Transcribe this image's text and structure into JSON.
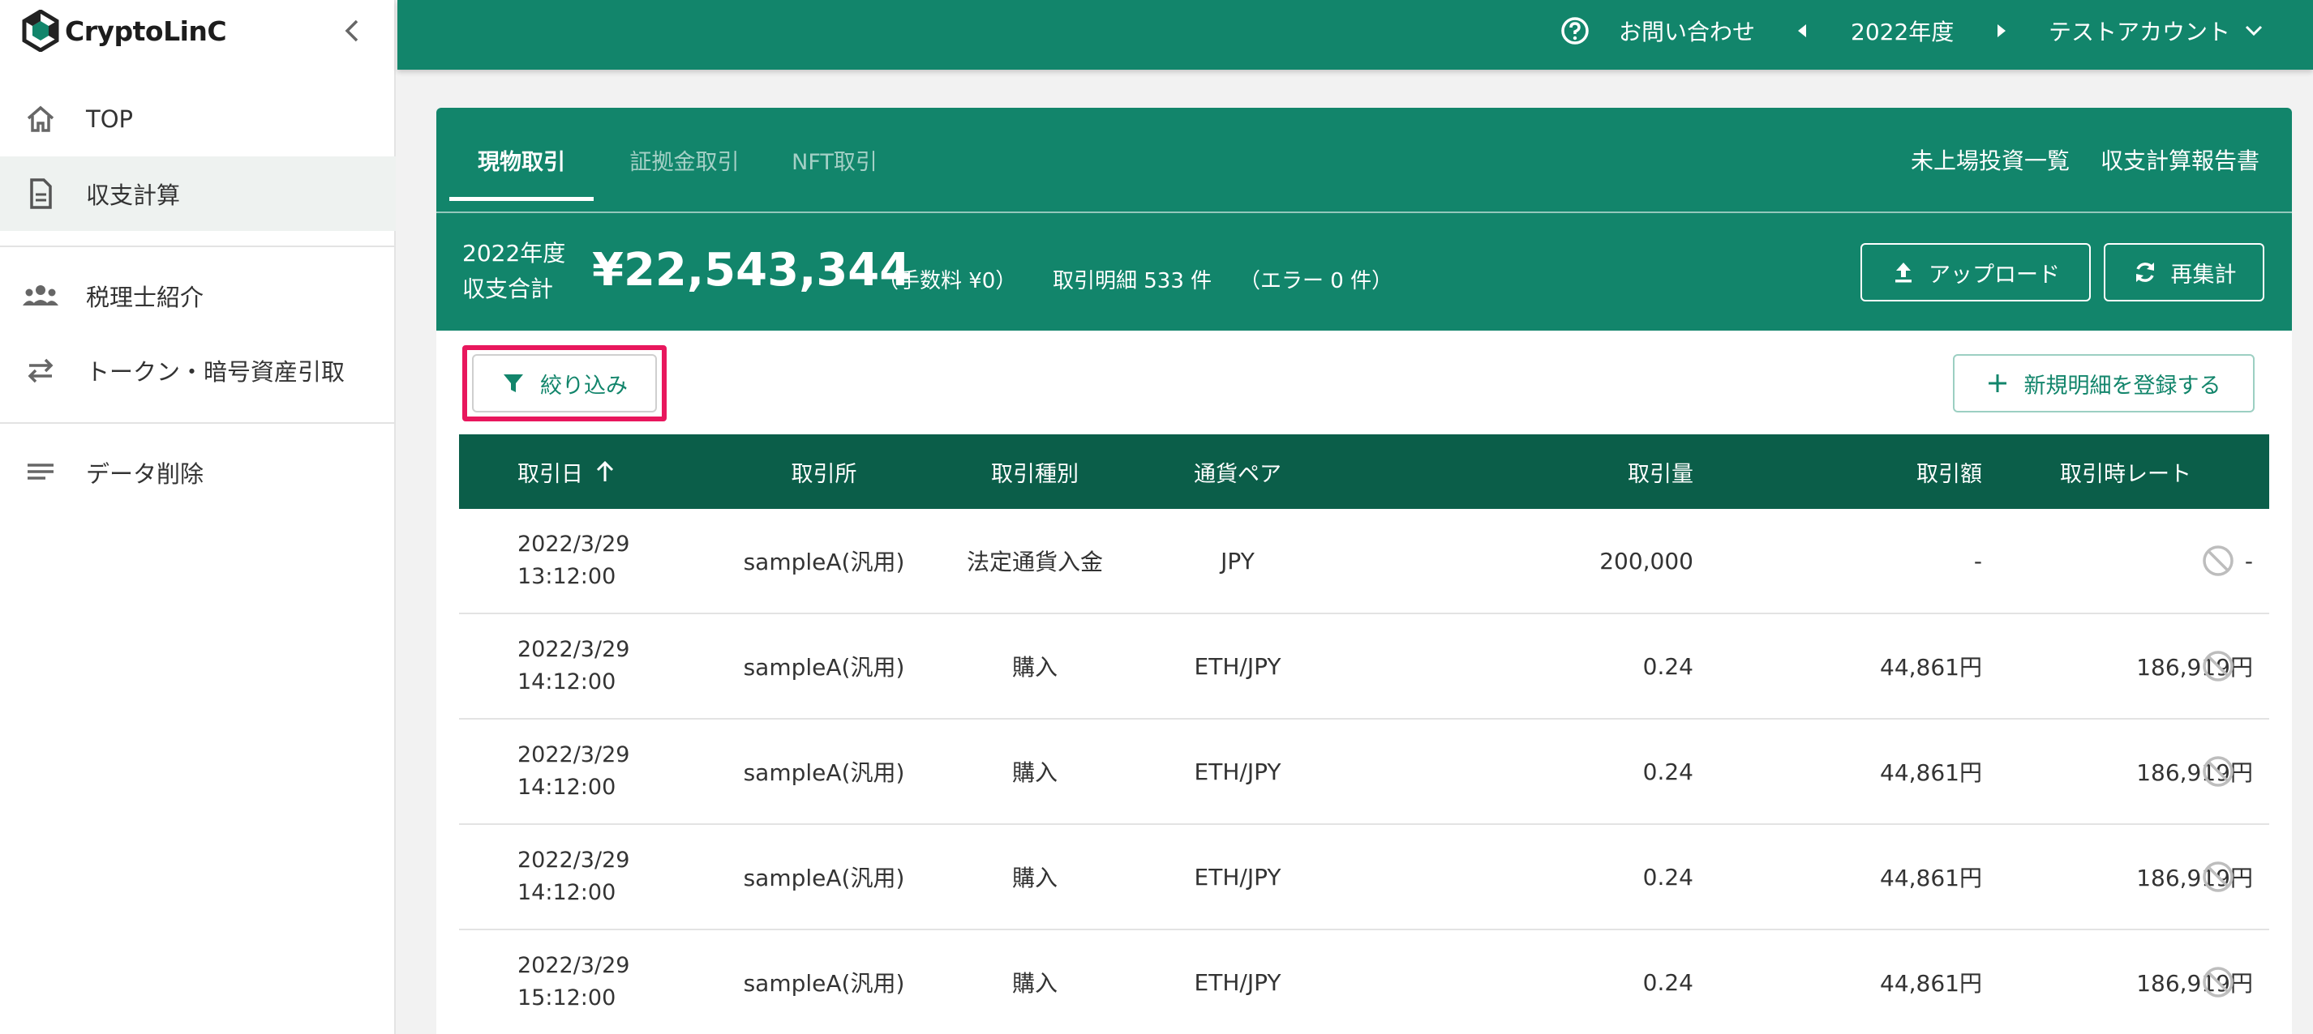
{
  "sidebar": {
    "brand": "CryptoLinC",
    "items": [
      {
        "label": "TOP",
        "icon": "home-icon"
      },
      {
        "label": "収支計算",
        "icon": "document-icon",
        "active": true
      },
      {
        "label": "税理士紹介",
        "icon": "people-icon"
      },
      {
        "label": "トークン・暗号資産引取",
        "icon": "swap-arrows-icon"
      },
      {
        "label": "データ削除",
        "icon": "lines-icon"
      }
    ]
  },
  "topbar": {
    "contact": "お問い合わせ",
    "year": "2022年度",
    "account": "テストアカウント"
  },
  "tabs": [
    {
      "label": "現物取引",
      "active": true
    },
    {
      "label": "証拠金取引"
    },
    {
      "label": "NFT取引"
    }
  ],
  "header_links": {
    "unlisted": "未上場投資一覧",
    "report": "収支計算報告書"
  },
  "summary": {
    "label_line1": "2022年度",
    "label_line2": "収支合計",
    "total": "¥22,543,344",
    "fee": "（手数料 ¥0）",
    "details": "取引明細 533 件",
    "errors": "（エラー 0 件）"
  },
  "buttons": {
    "upload": "アップロード",
    "recalc": "再集計",
    "filter": "絞り込み",
    "register": "新規明細を登録する"
  },
  "colors": {
    "brand_green": "#12856b",
    "table_header": "#0b5e49",
    "highlight": "#e8175d"
  },
  "table": {
    "columns": {
      "date": "取引日",
      "exchange": "取引所",
      "type": "取引種別",
      "pair": "通貨ペア",
      "amount": "取引量",
      "value": "取引額",
      "rate": "取引時レート"
    },
    "rows": [
      {
        "date": "2022/3/29",
        "time": "13:12:00",
        "exchange": "sampleA(汎用)",
        "type": "法定通貨入金",
        "pair": "JPY",
        "amount": "200,000",
        "value": "-",
        "rate": "-"
      },
      {
        "date": "2022/3/29",
        "time": "14:12:00",
        "exchange": "sampleA(汎用)",
        "type": "購入",
        "pair": "ETH/JPY",
        "amount": "0.24",
        "value": "44,861円",
        "rate": "186,919円"
      },
      {
        "date": "2022/3/29",
        "time": "14:12:00",
        "exchange": "sampleA(汎用)",
        "type": "購入",
        "pair": "ETH/JPY",
        "amount": "0.24",
        "value": "44,861円",
        "rate": "186,919円"
      },
      {
        "date": "2022/3/29",
        "time": "14:12:00",
        "exchange": "sampleA(汎用)",
        "type": "購入",
        "pair": "ETH/JPY",
        "amount": "0.24",
        "value": "44,861円",
        "rate": "186,919円"
      },
      {
        "date": "2022/3/29",
        "time": "15:12:00",
        "exchange": "sampleA(汎用)",
        "type": "購入",
        "pair": "ETH/JPY",
        "amount": "0.24",
        "value": "44,861円",
        "rate": "186,919円"
      }
    ]
  }
}
